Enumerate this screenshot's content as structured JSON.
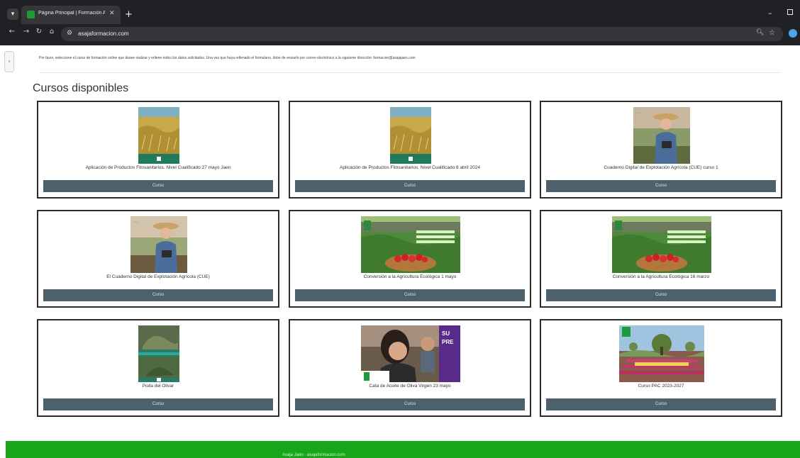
{
  "browser": {
    "tab_title": "Página Principal | Formación A",
    "url": "asajaformacion.com"
  },
  "page": {
    "intro": "Por favor, seleccione el curso de formación online que desee realizar y rellene todos los datos solicitados. Una vez que haya rellenado el formulario, debe de enviarlo por correo electrónico a la siguiente dirección: formacion@asajajaen.com",
    "section_title": "Cursos disponibles",
    "button_label": "Curso",
    "courses": [
      {
        "title": "Aplicación de Productos Fitosanitarios. Nivel Cualificado 27 mayo Jaen",
        "image": "wheat-field-cover"
      },
      {
        "title": "Aplicación de Productos Fitosanitarios. Nivel Cualificado 8 abril 2024",
        "image": "wheat-field-cover"
      },
      {
        "title": "Cuaderno Digital de Explotación Agrícola (CUE) curso 1",
        "image": "farmer-tablet"
      },
      {
        "title": "El Cuaderno Digital de Explotación Agrícola (CUE)",
        "image": "farmer-tablet"
      },
      {
        "title": "Conversión a la Agricultura Ecológica 1 mayo",
        "image": "tomato-basket"
      },
      {
        "title": "Conversión a la Agricultura Ecológica 16 marzo",
        "image": "tomato-basket"
      },
      {
        "title": "Poda del Olivar",
        "image": "olive-pruning"
      },
      {
        "title": "Cata de Aceite de Oliva Virgen 23 mayo",
        "image": "tasting-people"
      },
      {
        "title": "Curso PAC 2023-2027",
        "image": "flower-field"
      }
    ]
  },
  "footer": {
    "text": "Asaja Jaén · asajaformacion.com"
  }
}
